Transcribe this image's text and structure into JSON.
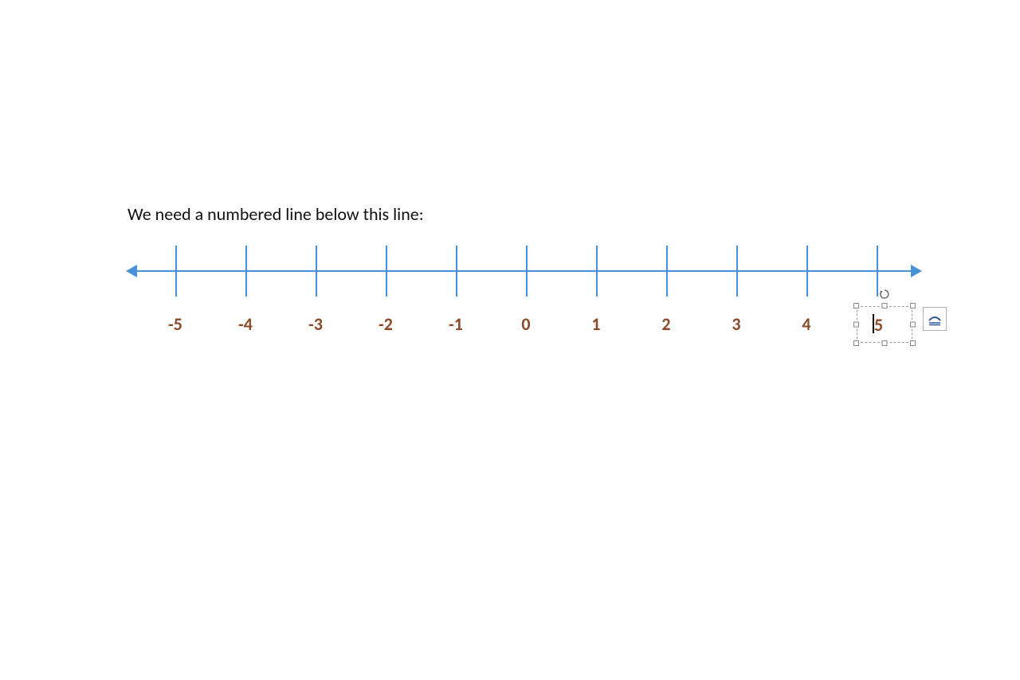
{
  "document": {
    "heading_text": "We need a numbered line below this line:"
  },
  "numberline": {
    "axis_color": "#4A90D9",
    "label_color": "#8B4A28",
    "ticks": [
      {
        "value": "-5",
        "pos": 60
      },
      {
        "value": "-4",
        "pos": 148
      },
      {
        "value": "-3",
        "pos": 236
      },
      {
        "value": "-2",
        "pos": 324
      },
      {
        "value": "-1",
        "pos": 412
      },
      {
        "value": "0",
        "pos": 500
      },
      {
        "value": "1",
        "pos": 588
      },
      {
        "value": "2",
        "pos": 676
      },
      {
        "value": "3",
        "pos": 764
      },
      {
        "value": "4",
        "pos": 852
      },
      {
        "value": "5",
        "pos": 940
      }
    ]
  },
  "selected_textbox": {
    "value": "5",
    "is_selected": true,
    "has_text_cursor": true
  },
  "smarttag": {
    "name": "layout-options",
    "tooltip": "Layout Options"
  }
}
